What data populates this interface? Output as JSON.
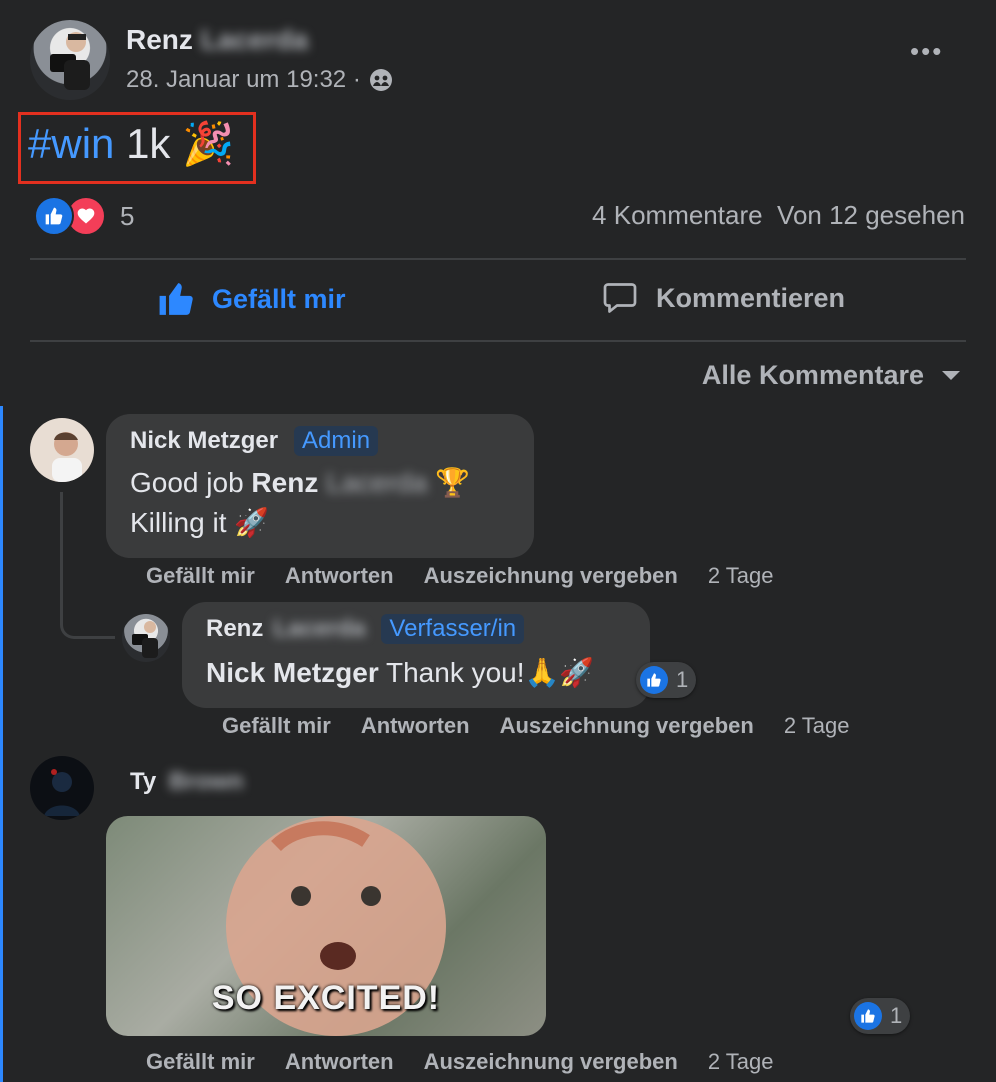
{
  "post": {
    "author_first": "Renz",
    "author_last_hidden": "Lacerda",
    "timestamp": "28. Januar um 19:32 ·",
    "hashtag": "#win",
    "text_after": "1k",
    "text_emoji": "🎉",
    "reaction_count": "5",
    "comments_count": "4 Kommentare",
    "views": "Von 12 gesehen",
    "like_label": "Gefällt mir",
    "comment_label": "Kommentieren",
    "filter_label": "Alle Kommentare",
    "more_label": "•••",
    "colors": {
      "background": "#242526",
      "accent": "#2d88ff",
      "highlight_box": "#e3301f"
    }
  },
  "comments": [
    {
      "author": "Nick Metzger",
      "badge": "Admin",
      "line1_prefix": "Good job",
      "line1_mention": "Renz",
      "line1_mention_hidden": "Lacerda",
      "line1_emoji": "🏆",
      "line2": "Killing it",
      "line2_emoji": "🚀",
      "actions": {
        "like": "Gefällt mir",
        "reply": "Antworten",
        "award": "Auszeichnung vergeben",
        "age": "2 Tage"
      }
    },
    {
      "author": "Renz",
      "author_hidden": "Lacerda",
      "badge": "Verfasser/in",
      "mention": "Nick Metzger",
      "text": "Thank you!",
      "emoji": "🙏🚀",
      "reaction_count": "1",
      "actions": {
        "like": "Gefällt mir",
        "reply": "Antworten",
        "award": "Auszeichnung vergeben",
        "age": "2 Tage"
      }
    },
    {
      "author": "Ty",
      "author_hidden": "Brown",
      "gif_caption": "SO EXCITED!",
      "reaction_count": "1",
      "actions": {
        "like": "Gefällt mir",
        "reply": "Antworten",
        "award": "Auszeichnung vergeben",
        "age": "2 Tage"
      }
    }
  ]
}
